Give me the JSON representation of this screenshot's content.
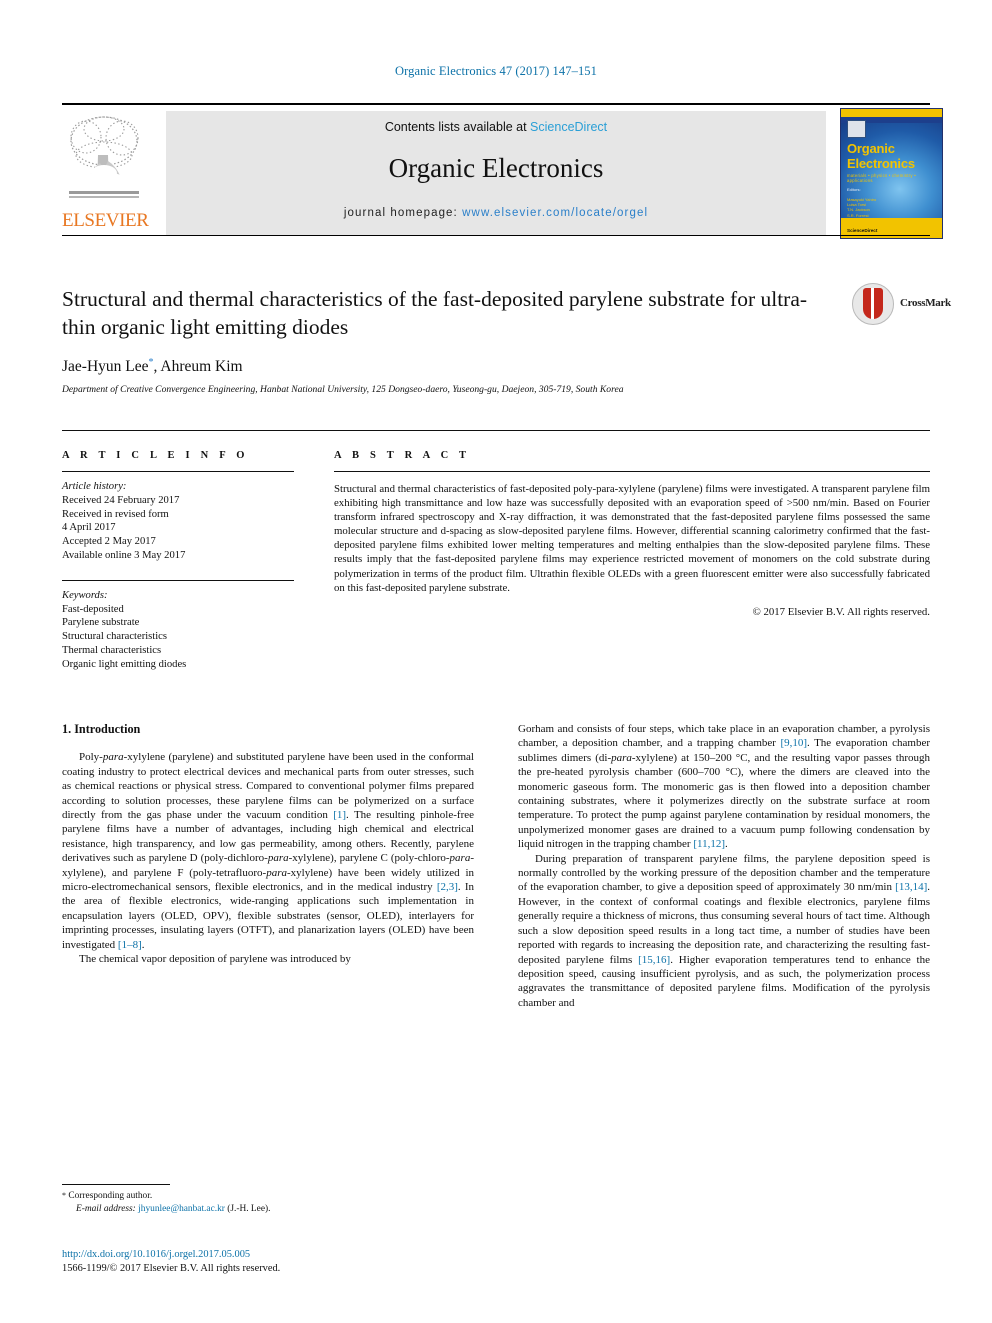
{
  "running_head": "Organic Electronics 47 (2017) 147–151",
  "masthead": {
    "contents_prefix": "Contents lists available at ",
    "sciencedirect": "ScienceDirect",
    "journal_name": "Organic Electronics",
    "homepage_label": "journal homepage: ",
    "homepage_url": "www.elsevier.com/locate/orgel",
    "publisher": "ELSEVIER",
    "cover": {
      "title_line1": "Organic",
      "title_line2": "Electronics",
      "subtitle": "materials • physics • chemistry • applications",
      "editors_label": "Editors:",
      "editors": "Masayuki Yahiro\nLuisa Torsi\nT.N. Jackson\nS.R. Forrest\nYong-Young Noh",
      "bottom_text": "ScienceDirect"
    }
  },
  "article": {
    "title": "Structural and thermal characteristics of the fast-deposited parylene substrate for ultra-thin organic light emitting diodes",
    "crossmark_label": "CrossMark",
    "authors": "Jae-Hyun Lee",
    "authors_marker": "*",
    "authors_rest": ", Ahreum Kim",
    "affiliation": "Department of Creative Convergence Engineering, Hanbat National University, 125 Dongseo-daero, Yuseong-gu, Daejeon, 305-719, South Korea"
  },
  "info": {
    "heading": "A R T I C L E   I N F O",
    "history_label": "Article history:",
    "history_lines": "Received 24 February 2017\nReceived in revised form\n4 April 2017\nAccepted 2 May 2017\nAvailable online 3 May 2017",
    "keywords_label": "Keywords:",
    "keywords": "Fast-deposited\nParylene substrate\nStructural characteristics\nThermal characteristics\nOrganic light emitting diodes"
  },
  "abstract": {
    "heading": "A B S T R A C T",
    "text": "Structural and thermal characteristics of fast-deposited poly-para-xylylene (parylene) films were investigated. A transparent parylene film exhibiting high transmittance and low haze was successfully deposited with an evaporation speed of >500 nm/min. Based on Fourier transform infrared spectroscopy and X-ray diffraction, it was demonstrated that the fast-deposited parylene films possessed the same molecular structure and d-spacing as slow-deposited parylene films. However, differential scanning calorimetry confirmed that the fast-deposited parylene films exhibited lower melting temperatures and melting enthalpies than the slow-deposited parylene films. These results imply that the fast-deposited parylene films may experience restricted movement of monomers on the cold substrate during polymerization in terms of the product film. Ultrathin flexible OLEDs with a green fluorescent emitter were also successfully fabricated on this fast-deposited parylene substrate.",
    "copyright": "© 2017 Elsevier B.V. All rights reserved."
  },
  "body": {
    "section_heading": "1.  Introduction",
    "left_para1_a": "Poly-",
    "left_para1_em1": "para",
    "left_para1_b": "-xylylene (parylene) and substituted parylene have been used in the conformal coating industry to protect electrical devices and mechanical parts from outer stresses, such as chemical reactions or physical stress. Compared to conventional polymer films prepared according to solution processes, these parylene films can be polymerized on a surface directly from the gas phase under the vacuum condition ",
    "left_cite1": "[1]",
    "left_para1_c": ". The resulting pinhole-free parylene films have a number of advantages, including high chemical and electrical resistance, high transparency, and low gas permeability, among others. Recently, parylene derivatives such as parylene D (poly-dichloro-",
    "left_para1_em2": "para",
    "left_para1_d": "-xylylene), parylene C (poly-chloro-",
    "left_para1_em3": "para",
    "left_para1_e": "-xylylene), and parylene F (poly-tetrafluoro-",
    "left_para1_em4": "para",
    "left_para1_f": "-xylylene) have been widely utilized in micro-electromechanical sensors, flexible electronics, and in the medical industry ",
    "left_cite2": "[2,3]",
    "left_para1_g": ". In the area of flexible electronics, wide-ranging applications such implementation in encapsulation layers (OLED, OPV), flexible substrates (sensor, OLED), interlayers for imprinting processes, insulating layers (OTFT), and planarization layers (OLED) have been investigated ",
    "left_cite3": "[1–8]",
    "left_para1_h": ".",
    "left_para2": "The chemical vapor deposition of parylene was introduced by",
    "right_para1_a": "Gorham and consists of four steps, which take place in an evaporation chamber, a pyrolysis chamber, a deposition chamber, and a trapping chamber ",
    "right_cite1": "[9,10]",
    "right_para1_b": ". The evaporation chamber sublimes dimers (di-",
    "right_para1_em1": "para",
    "right_para1_c": "-xylylene) at 150–200 °C, and the resulting vapor passes through the pre-heated pyrolysis chamber (600–700 °C), where the dimers are cleaved into the monomeric gaseous form. The monomeric gas is then flowed into a deposition chamber containing substrates, where it polymerizes directly on the substrate surface at room temperature. To protect the pump against parylene contamination by residual monomers, the unpolymerized monomer gases are drained to a vacuum pump following condensation by liquid nitrogen in the trapping chamber ",
    "right_cite2": "[11,12]",
    "right_para1_d": ".",
    "right_para2_a": "During preparation of transparent parylene films, the parylene deposition speed is normally controlled by the working pressure of the deposition chamber and the temperature of the evaporation chamber, to give a deposition speed of approximately 30 nm/min ",
    "right_cite3": "[13,14]",
    "right_para2_b": ". However, in the context of conformal coatings and flexible electronics, parylene films generally require a thickness of microns, thus consuming several hours of tact time. Although such a slow deposition speed results in a long tact time, a number of studies have been reported with regards to increasing the deposition rate, and characterizing the resulting fast-deposited parylene films ",
    "right_cite4": "[15,16]",
    "right_para2_c": ". Higher evaporation temperatures tend to enhance the deposition speed, causing insufficient pyrolysis, and as such, the polymerization process aggravates the transmittance of deposited parylene films. Modification of the pyrolysis chamber and"
  },
  "footnote": {
    "marker": "*",
    "corresponding": " Corresponding author.",
    "email_label": "E-mail address:",
    "email": "jhyunlee@hanbat.ac.kr",
    "email_suffix": " (J.-H. Lee)."
  },
  "footer": {
    "doi": "http://dx.doi.org/10.1016/j.orgel.2017.05.005",
    "issn": "1566-1199/© 2017 Elsevier B.V. All rights reserved."
  },
  "colors": {
    "link": "#0d72a8",
    "elsevier_orange": "#e87722",
    "sciencedirect_blue": "#2a9fd6",
    "cover_yellow": "#f2c300",
    "crossmark_red": "#c4281c"
  }
}
